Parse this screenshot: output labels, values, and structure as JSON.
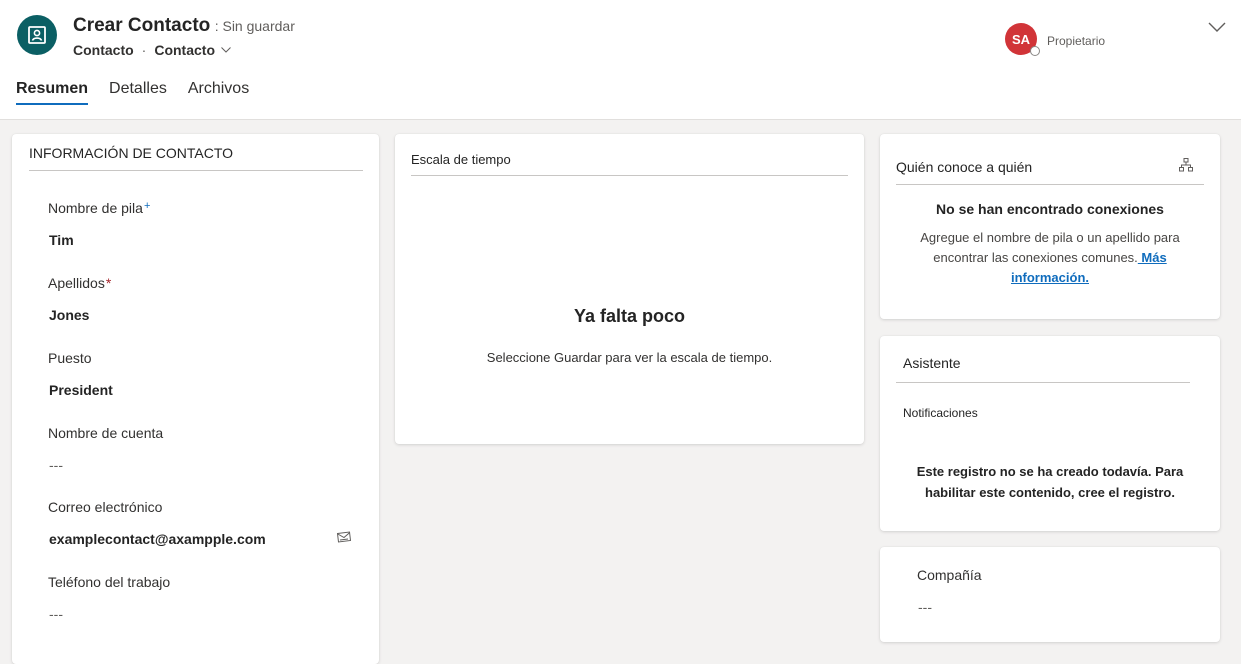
{
  "header": {
    "title": "Crear Contacto",
    "status": ": Sin guardar",
    "breadcrumb": [
      "Contacto",
      "Contacto"
    ],
    "owner": {
      "initials": "SA",
      "label": "Propietario"
    },
    "icons": {
      "entity": "contact-card-icon",
      "expand": "chevron-down-icon"
    }
  },
  "tabs": [
    {
      "label": "Resumen",
      "active": true
    },
    {
      "label": "Detalles",
      "active": false
    },
    {
      "label": "Archivos",
      "active": false
    }
  ],
  "contact": {
    "section_title": "INFORMACIÓN DE CONTACTO",
    "fields": [
      {
        "label": "Nombre de pila",
        "marker": "+",
        "value": "Tim"
      },
      {
        "label": "Apellidos",
        "marker": "*",
        "value": "Jones"
      },
      {
        "label": "Puesto",
        "value": "President"
      },
      {
        "label": "Nombre de cuenta",
        "value": "---"
      },
      {
        "label": "Correo electrónico",
        "value": "examplecontact@axampple.com",
        "action_icon": "email-compose-icon"
      },
      {
        "label": "Teléfono del trabajo",
        "value": "---"
      }
    ]
  },
  "timeline": {
    "title": "Escala de tiempo",
    "heading": "Ya falta poco",
    "message": "Seleccione Guardar para ver la escala de tiempo."
  },
  "who_knows": {
    "title": "Quién conoce a quién",
    "icon": "org-chart-icon",
    "heading": "No se han encontrado conexiones",
    "message": "Agregue el nombre de pila o un apellido para encontrar las conexiones comunes.",
    "link": " Más información."
  },
  "assistant": {
    "title": "Asistente",
    "subtitle": "Notificaciones",
    "message": "Este registro no se ha creado todavía. Para habilitar este contenido, cree el registro."
  },
  "company": {
    "label": "Compañía",
    "value": "---"
  },
  "colors": {
    "accent": "#0f6cbd",
    "entity_icon_bg": "#0b5f64",
    "avatar_bg": "#d13438",
    "required": "#a4262c"
  }
}
